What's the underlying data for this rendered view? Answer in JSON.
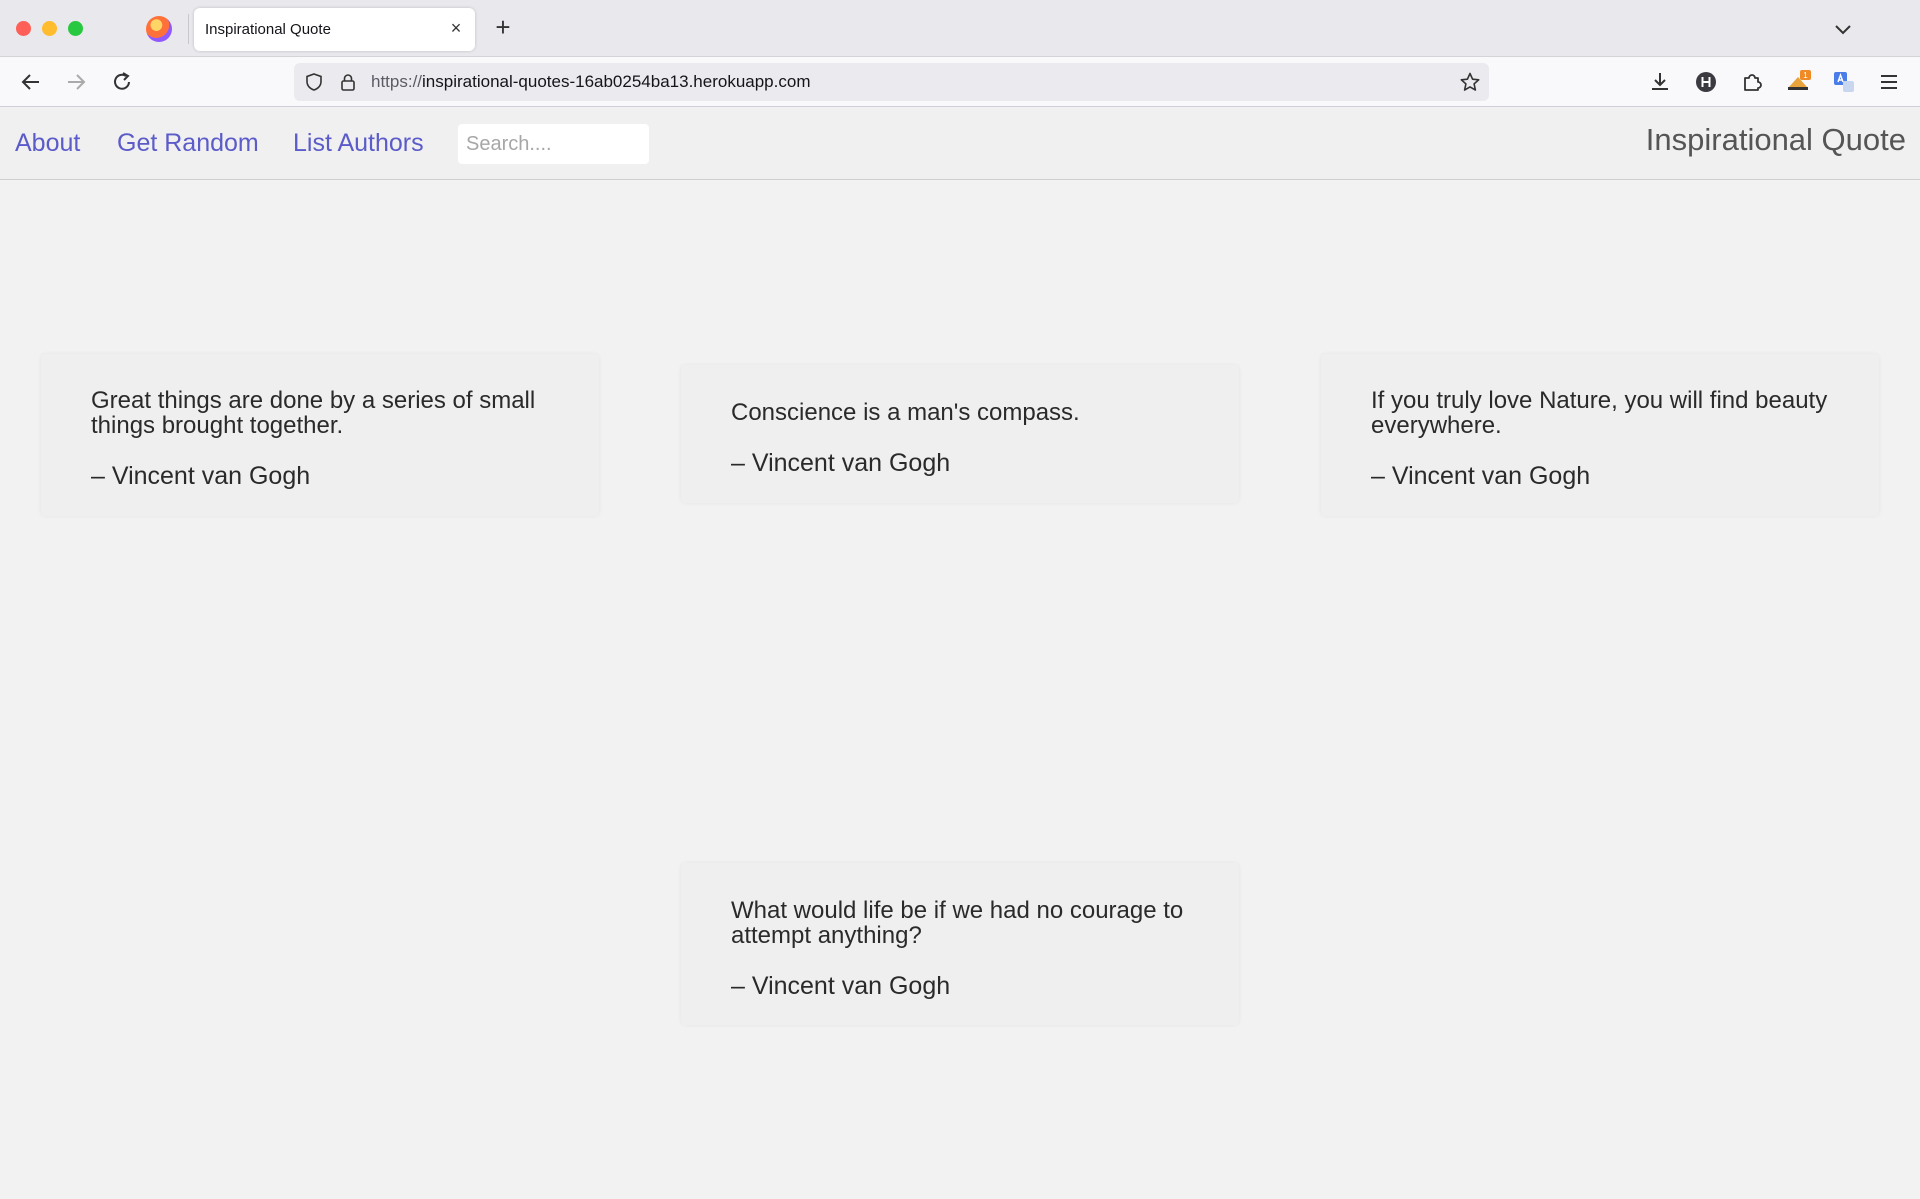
{
  "browser": {
    "tab_title": "Inspirational Quote",
    "url_protocol": "https://",
    "url_host": "inspirational-quotes-16ab0254ba13.herokuapp.com",
    "toolbar_icons": [
      "download-icon",
      "h-extension-icon",
      "extensions-icon",
      "notification-extension-icon",
      "translate-extension-icon",
      "menu-icon"
    ],
    "extension_badge": "1"
  },
  "site": {
    "nav": {
      "about": "About",
      "random": "Get Random",
      "authors": "List Authors",
      "search_placeholder": "Search....",
      "brand": "Inspirational Quote"
    },
    "accent_color": "#5b5bc9",
    "quotes": [
      {
        "text": "Great things are done by a series of small things brought together.",
        "author": "– Vincent van Gogh"
      },
      {
        "text": "Conscience is a man's compass.",
        "author": "– Vincent van Gogh"
      },
      {
        "text": "If you truly love Nature, you will find beauty everywhere.",
        "author": "– Vincent van Gogh"
      },
      {
        "text": "What would life be if we had no courage to attempt anything?",
        "author": "– Vincent van Gogh"
      }
    ]
  }
}
